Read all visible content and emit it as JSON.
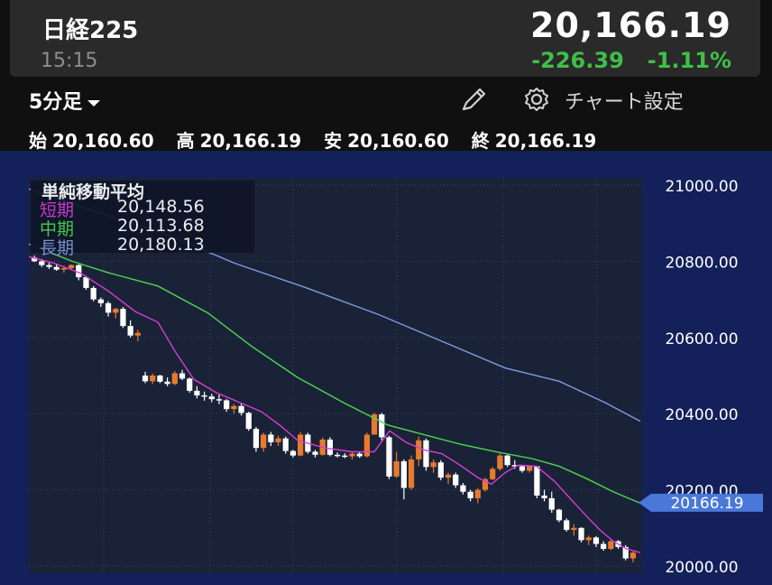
{
  "header": {
    "title": "日経225",
    "time": "15:15",
    "price": "20,166.19",
    "change": "-226.39",
    "change_pct": "-1.11%",
    "change_color": "#3fbf48"
  },
  "controls": {
    "timeframe": "5分足",
    "settings_label": "チャート設定",
    "icons": [
      "chevron-down-icon",
      "pencil-icon",
      "gear-icon"
    ]
  },
  "ohlc": {
    "open_label": "始",
    "open": "20,160.60",
    "high_label": "高",
    "high": "20,166.19",
    "low_label": "安",
    "low": "20,160.60",
    "close_label": "終",
    "close": "20,166.19"
  },
  "legend": {
    "title": "単純移動平均",
    "short_label": "短期",
    "short_value": "20,148.56",
    "short_color": "#d83cd8",
    "mid_label": "中期",
    "mid_value": "20,113.68",
    "mid_color": "#4bd84b",
    "long_label": "長期",
    "long_value": "20,180.13",
    "long_color": "#7d9be0"
  },
  "chart_data": {
    "type": "candlestick",
    "ylim": [
      20000,
      21000
    ],
    "y_ticks": [
      "21000.00",
      "20800.00",
      "20600.00",
      "20400.00",
      "20200.00",
      "20000.00"
    ],
    "y_tick_values": [
      21000,
      20800,
      20600,
      20400,
      20200,
      20000
    ],
    "current_price_label": "20166.19",
    "current_price": 20166.19,
    "up_color": "#e87a2e",
    "down_color": "#ffffff",
    "candles": [
      [
        20810,
        20815,
        20798,
        20800
      ],
      [
        20800,
        20806,
        20785,
        20790
      ],
      [
        20790,
        20797,
        20780,
        20785
      ],
      [
        20785,
        20792,
        20775,
        20778
      ],
      [
        20778,
        20788,
        20770,
        20782
      ],
      [
        20782,
        20792,
        20776,
        20790
      ],
      [
        20790,
        20792,
        20750,
        20758
      ],
      [
        20758,
        20762,
        20725,
        20730
      ],
      [
        20730,
        20735,
        20695,
        20700
      ],
      [
        20700,
        20705,
        20680,
        20690
      ],
      [
        20690,
        20695,
        20655,
        20665
      ],
      [
        20665,
        20678,
        20650,
        20675
      ],
      [
        20675,
        20680,
        20625,
        20630
      ],
      [
        20630,
        20645,
        20600,
        20605
      ],
      [
        20605,
        20620,
        20590,
        20612
      ],
      [
        20500,
        20510,
        20480,
        20485
      ],
      [
        20485,
        20505,
        20478,
        20500
      ],
      [
        20500,
        20502,
        20480,
        20484
      ],
      [
        20484,
        20495,
        20472,
        20478
      ],
      [
        20478,
        20512,
        20475,
        20506
      ],
      [
        20506,
        20515,
        20488,
        20492
      ],
      [
        20492,
        20495,
        20455,
        20460
      ],
      [
        20460,
        20472,
        20440,
        20448
      ],
      [
        20448,
        20458,
        20434,
        20445
      ],
      [
        20445,
        20452,
        20430,
        20438
      ],
      [
        20438,
        20450,
        20425,
        20435
      ],
      [
        20435,
        20438,
        20405,
        20412
      ],
      [
        20412,
        20425,
        20400,
        20420
      ],
      [
        20420,
        20428,
        20395,
        20402
      ],
      [
        20402,
        20405,
        20355,
        20360
      ],
      [
        20360,
        20365,
        20300,
        20310
      ],
      [
        20310,
        20350,
        20300,
        20345
      ],
      [
        20345,
        20352,
        20315,
        20325
      ],
      [
        20325,
        20342,
        20315,
        20335
      ],
      [
        20335,
        20340,
        20295,
        20302
      ],
      [
        20302,
        20305,
        20285,
        20290
      ],
      [
        20290,
        20352,
        20288,
        20345
      ],
      [
        20345,
        20350,
        20295,
        20300
      ],
      [
        20300,
        20305,
        20285,
        20292
      ],
      [
        20292,
        20337,
        20290,
        20332
      ],
      [
        20332,
        20338,
        20288,
        20292
      ],
      [
        20292,
        20298,
        20285,
        20290
      ],
      [
        20290,
        20296,
        20283,
        20288
      ],
      [
        20288,
        20300,
        20280,
        20295
      ],
      [
        20295,
        20300,
        20284,
        20288
      ],
      [
        20288,
        20350,
        20285,
        20345
      ],
      [
        20345,
        20402,
        20345,
        20398
      ],
      [
        20398,
        20402,
        20330,
        20338
      ],
      [
        20338,
        20342,
        20228,
        20235
      ],
      [
        20235,
        20300,
        20232,
        20275
      ],
      [
        20275,
        20280,
        20175,
        20205
      ],
      [
        20205,
        20290,
        20200,
        20280
      ],
      [
        20280,
        20340,
        20262,
        20330
      ],
      [
        20330,
        20335,
        20250,
        20260
      ],
      [
        20260,
        20280,
        20245,
        20272
      ],
      [
        20272,
        20278,
        20225,
        20232
      ],
      [
        20232,
        20245,
        20215,
        20240
      ],
      [
        20240,
        20245,
        20205,
        20212
      ],
      [
        20212,
        20218,
        20188,
        20195
      ],
      [
        20195,
        20200,
        20170,
        20178
      ],
      [
        20178,
        20205,
        20165,
        20200
      ],
      [
        20200,
        20232,
        20195,
        20228
      ],
      [
        20228,
        20260,
        20225,
        20255
      ],
      [
        20255,
        20295,
        20250,
        20290
      ],
      [
        20290,
        20292,
        20260,
        20265
      ],
      [
        20265,
        20278,
        20255,
        20262
      ],
      [
        20262,
        20264,
        20245,
        20250
      ],
      [
        20250,
        20264,
        20245,
        20262
      ],
      [
        20262,
        20262,
        20178,
        20185
      ],
      [
        20185,
        20200,
        20170,
        20178
      ],
      [
        20178,
        20195,
        20140,
        20148
      ],
      [
        20148,
        20150,
        20115,
        20120
      ],
      [
        20120,
        20125,
        20090,
        20095
      ],
      [
        20095,
        20110,
        20080,
        20100
      ],
      [
        20100,
        20102,
        20062,
        20068
      ],
      [
        20068,
        20080,
        20055,
        20075
      ],
      [
        20075,
        20078,
        20050,
        20058
      ],
      [
        20058,
        20065,
        20040,
        20045
      ],
      [
        20045,
        20068,
        20042,
        20065
      ],
      [
        20065,
        20068,
        20045,
        20050
      ],
      [
        20050,
        20055,
        20015,
        20020
      ],
      [
        20020,
        20038,
        20010,
        20035
      ]
    ],
    "sma_short": [
      [
        32,
        20812
      ],
      [
        60,
        20795
      ],
      [
        90,
        20768
      ],
      [
        120,
        20722
      ],
      [
        150,
        20668
      ],
      [
        175,
        20640
      ],
      [
        195,
        20560
      ],
      [
        215,
        20490
      ],
      [
        240,
        20455
      ],
      [
        270,
        20425
      ],
      [
        290,
        20405
      ],
      [
        310,
        20370
      ],
      [
        330,
        20330
      ],
      [
        360,
        20310
      ],
      [
        390,
        20300
      ],
      [
        415,
        20300
      ],
      [
        432,
        20355
      ],
      [
        450,
        20325
      ],
      [
        470,
        20305
      ],
      [
        490,
        20295
      ],
      [
        510,
        20265
      ],
      [
        530,
        20232
      ],
      [
        545,
        20215
      ],
      [
        560,
        20245
      ],
      [
        575,
        20265
      ],
      [
        595,
        20262
      ],
      [
        615,
        20222
      ],
      [
        635,
        20170
      ],
      [
        650,
        20132
      ],
      [
        665,
        20095
      ],
      [
        680,
        20065
      ],
      [
        695,
        20045
      ],
      [
        710,
        20035
      ]
    ],
    "sma_mid": [
      [
        32,
        20845
      ],
      [
        80,
        20800
      ],
      [
        120,
        20770
      ],
      [
        175,
        20735
      ],
      [
        230,
        20665
      ],
      [
        280,
        20575
      ],
      [
        330,
        20495
      ],
      [
        380,
        20430
      ],
      [
        430,
        20370
      ],
      [
        470,
        20345
      ],
      [
        510,
        20320
      ],
      [
        550,
        20300
      ],
      [
        590,
        20282
      ],
      [
        620,
        20262
      ],
      [
        650,
        20230
      ],
      [
        680,
        20195
      ],
      [
        710,
        20165
      ]
    ],
    "sma_long": [
      [
        32,
        20990
      ],
      [
        100,
        20935
      ],
      [
        180,
        20875
      ],
      [
        260,
        20795
      ],
      [
        340,
        20730
      ],
      [
        420,
        20660
      ],
      [
        500,
        20580
      ],
      [
        560,
        20520
      ],
      [
        620,
        20485
      ],
      [
        670,
        20430
      ],
      [
        710,
        20380
      ]
    ]
  }
}
